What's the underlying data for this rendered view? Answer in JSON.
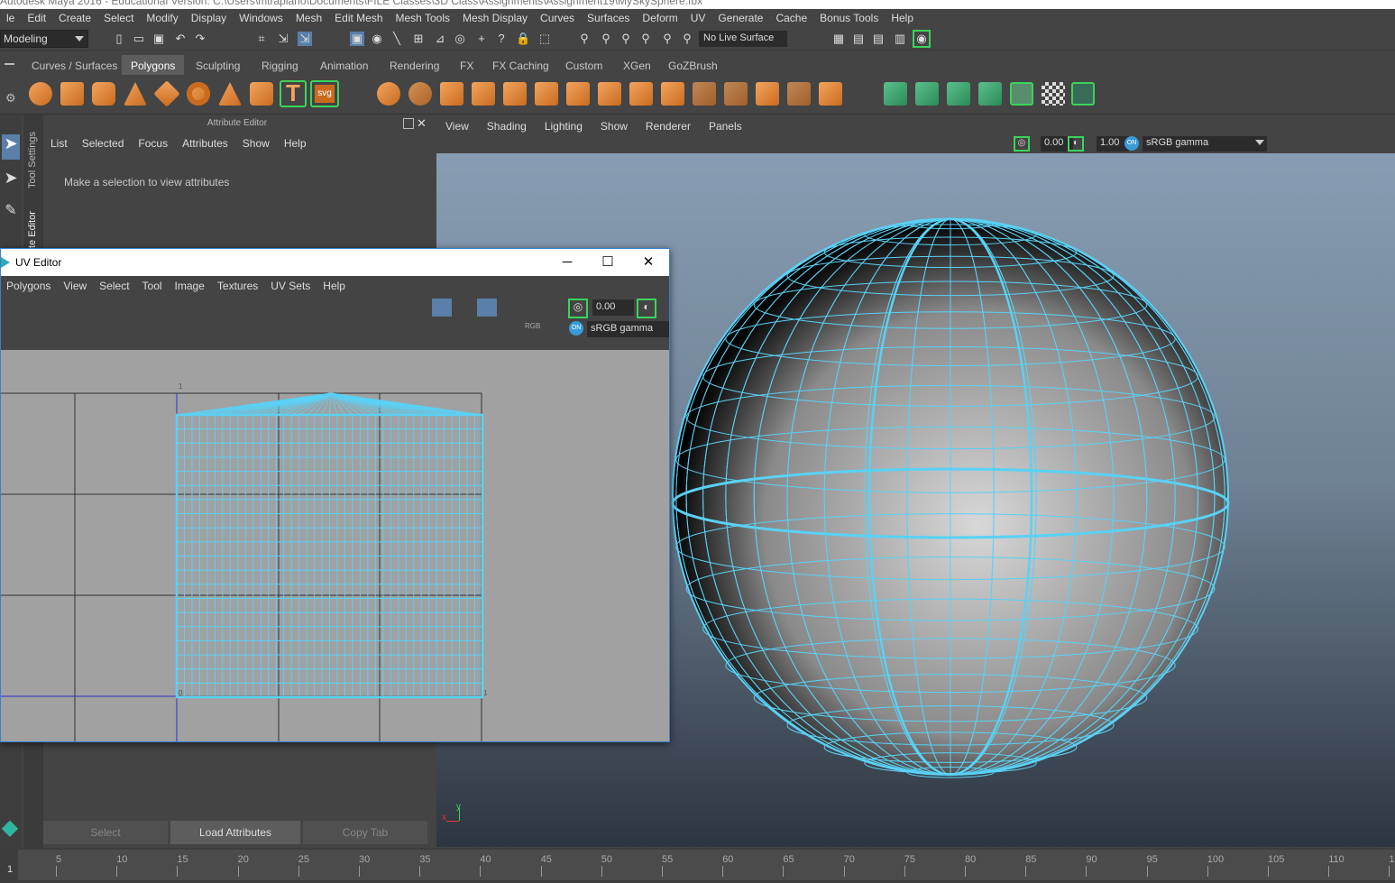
{
  "window": {
    "title": "Autodesk Maya 2016 - Educational Version: C:\\Users\\mtrapiano\\Documents\\FILE Classes\\3D Class\\Assignments\\Assignment19\\MySkySphere.fbx"
  },
  "menubar": {
    "items": [
      "le",
      "Edit",
      "Create",
      "Select",
      "Modify",
      "Display",
      "Windows",
      "Mesh",
      "Edit Mesh",
      "Mesh Tools",
      "Mesh Display",
      "Curves",
      "Surfaces",
      "Deform",
      "UV",
      "Generate",
      "Cache",
      "Bonus Tools",
      "Help"
    ]
  },
  "statusline": {
    "mode": "Modeling",
    "live_surface": "No Live Surface"
  },
  "shelf": {
    "tabs": [
      "Curves / Surfaces",
      "Polygons",
      "Sculpting",
      "Rigging",
      "Animation",
      "Rendering",
      "FX",
      "FX Caching",
      "Custom",
      "XGen",
      "GoZBrush"
    ],
    "active": "Polygons"
  },
  "side_tabs": {
    "tool_settings": "Tool Settings",
    "attribute_editor": "te Editor"
  },
  "attribute_editor": {
    "header": "Attribute Editor",
    "menu": [
      "List",
      "Selected",
      "Focus",
      "Attributes",
      "Show",
      "Help"
    ],
    "message": "Make a selection to view attributes",
    "buttons": {
      "select": "Select",
      "load": "Load Attributes",
      "copy": "Copy Tab"
    }
  },
  "viewport": {
    "menu": [
      "View",
      "Shading",
      "Lighting",
      "Show",
      "Renderer",
      "Panels"
    ],
    "exposure": "0.00",
    "gamma": "1.00",
    "color_space": "sRGB gamma",
    "axis_x": "x",
    "axis_y": "y"
  },
  "uv_editor": {
    "title": "UV Editor",
    "menu": [
      "Polygons",
      "View",
      "Select",
      "Tool",
      "Image",
      "Textures",
      "UV Sets",
      "Help"
    ],
    "value": "0.00",
    "color_space": "sRGB gamma",
    "rgb": "RGB",
    "corner_labels": [
      "1",
      "0",
      "1"
    ]
  },
  "timeline": {
    "start": "1",
    "ticks": [
      "5",
      "10",
      "15",
      "20",
      "25",
      "30",
      "35",
      "40",
      "45",
      "50",
      "55",
      "60",
      "65",
      "70",
      "75",
      "80",
      "85",
      "90",
      "95",
      "100",
      "105",
      "110",
      "1"
    ]
  },
  "colors": {
    "wire": "#5ad1f5",
    "accent": "#e8964a",
    "active_tab": "#5d5d5d"
  }
}
